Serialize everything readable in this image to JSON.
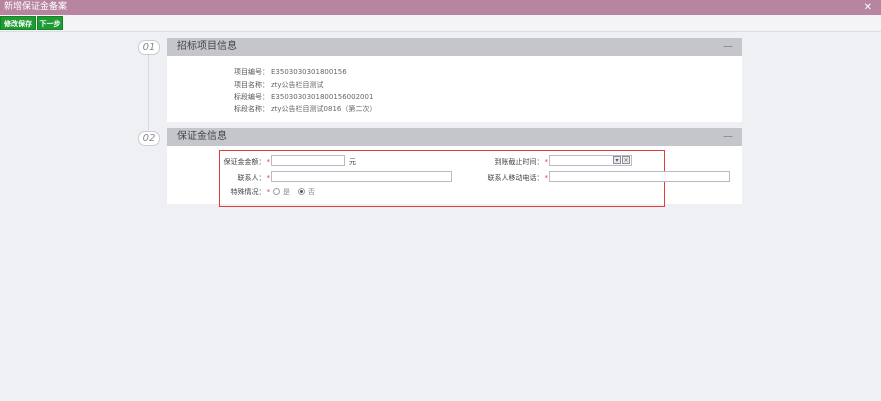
{
  "window": {
    "title": "新增保证金备案",
    "close_symbol": "✕"
  },
  "toolbar": {
    "modify_save_label": "修改保存",
    "next_step_label": "下一步"
  },
  "steps": {
    "step1_number": "01",
    "step2_number": "02"
  },
  "section1": {
    "title": "招标项目信息",
    "collapse_symbol": "—",
    "rows": [
      {
        "label": "项目编号：",
        "value": "E3503030301800156"
      },
      {
        "label": "项目名称：",
        "value": "zty公告栏目测试"
      },
      {
        "label": "标段编号：",
        "value": "E3503030301800156002001"
      },
      {
        "label": "标段名称：",
        "value": "zty公告栏目测试0816（第二次）"
      }
    ]
  },
  "section2": {
    "title": "保证金信息",
    "collapse_symbol": "—",
    "required_mark": "*",
    "fields": {
      "amount_label": "保证金金额：",
      "amount_value": "",
      "amount_unit": "元",
      "deadline_label": "到账截止时间：",
      "deadline_value": "",
      "contact_label": "联系人：",
      "contact_value": "",
      "phone_label": "联系人移动电话：",
      "phone_value": "",
      "special_label": "特殊情况：",
      "special_options": [
        "是",
        "否"
      ],
      "special_selected": "否"
    }
  },
  "colors": {
    "titlebar": "#b7859f",
    "button_green": "#1f9b33",
    "highlight_border": "#e23a3a"
  }
}
